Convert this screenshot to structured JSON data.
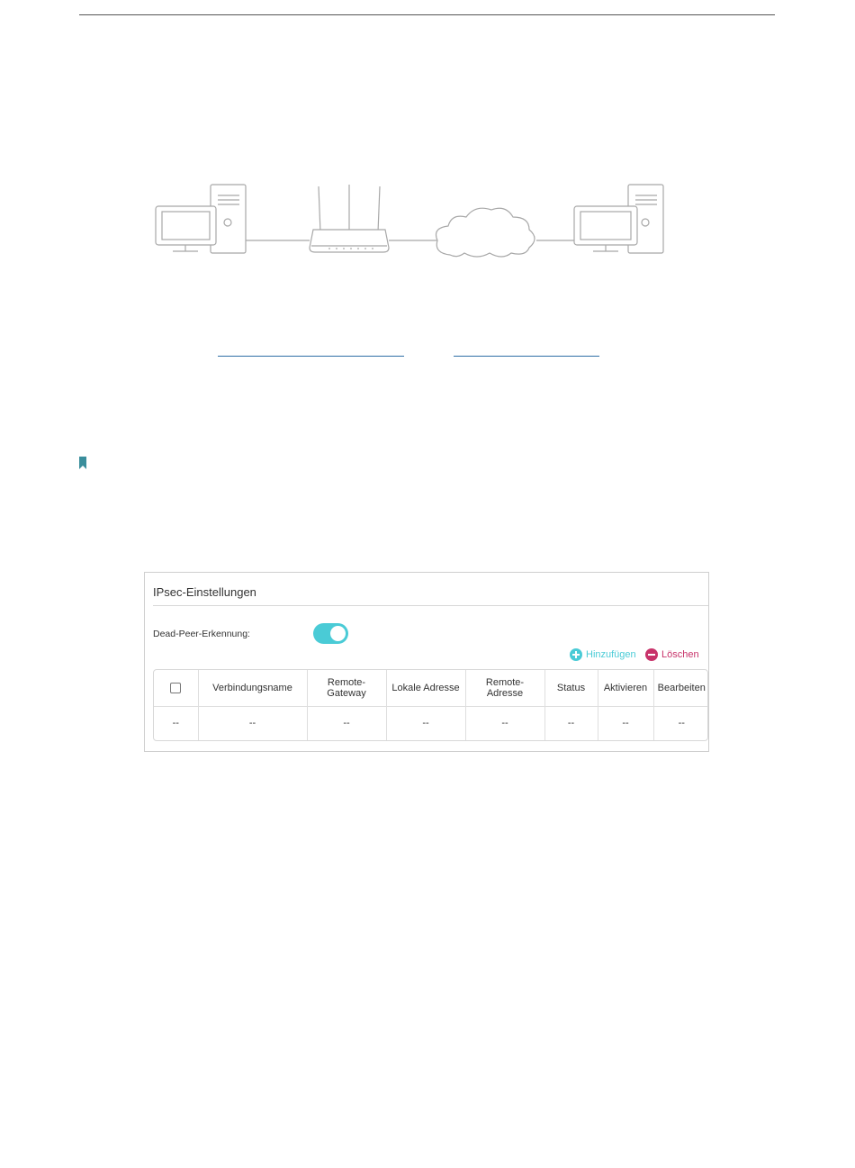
{
  "ipsec": {
    "title": "IPsec-Einstellungen",
    "dead_peer_label": "Dead-Peer-Erkennung:",
    "dead_peer_enabled": true,
    "add_label": "Hinzufügen",
    "delete_label": "Löschen",
    "columns": [
      "Verbindungsname",
      "Remote-Gateway",
      "Lokale Adresse",
      "Remote-Adresse",
      "Status",
      "Aktivieren",
      "Bearbeiten"
    ],
    "row": [
      "--",
      "--",
      "--",
      "--",
      "--",
      "--",
      "--",
      "--"
    ]
  },
  "colors": {
    "accent": "#4acbd6",
    "delete": "#c8336a",
    "bookmark": "#3a8e9c",
    "link": "#2f6fa6"
  }
}
